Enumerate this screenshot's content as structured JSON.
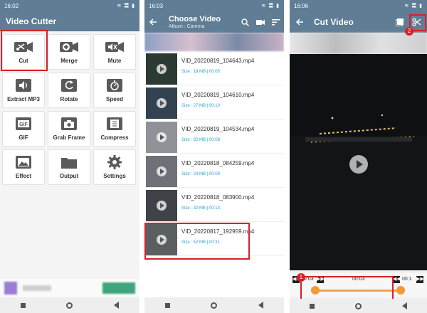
{
  "panel1": {
    "status_time": "16:02",
    "status_right": "≋ 〓 ▮",
    "title": "Video Cutter",
    "tools": [
      {
        "label": "Cut",
        "icon": "scissors-film-icon"
      },
      {
        "label": "Merge",
        "icon": "plus-film-icon"
      },
      {
        "label": "Mute",
        "icon": "mute-film-icon"
      },
      {
        "label": "Extract MP3",
        "icon": "speaker-icon"
      },
      {
        "label": "Rotate",
        "icon": "rotate-icon"
      },
      {
        "label": "Speed",
        "icon": "stopwatch-icon"
      },
      {
        "label": "GIF",
        "icon": "gif-icon"
      },
      {
        "label": "Grab Frame",
        "icon": "camera-icon"
      },
      {
        "label": "Compress",
        "icon": "compress-icon"
      },
      {
        "label": "Effect",
        "icon": "effect-icon"
      },
      {
        "label": "Output",
        "icon": "folder-icon"
      },
      {
        "label": "Settings",
        "icon": "gear-icon"
      }
    ]
  },
  "panel2": {
    "status_time": "16:03",
    "status_right": "≋ 〓 ▮",
    "title": "Choose Video",
    "subtitle": "Album : Camera",
    "videos": [
      {
        "name": "VID_20220819_104643.mp4",
        "meta": "Size : 18 MB | 00:05"
      },
      {
        "name": "VID_20220819_104610.mp4",
        "meta": "Size : 27 MB | 00:10"
      },
      {
        "name": "VID_20220819_104534.mp4",
        "meta": "Size : 32 MB | 00:08"
      },
      {
        "name": "VID_20220818_084259.mp4",
        "meta": "Size : 24 MB | 00:09"
      },
      {
        "name": "VID_20220818_083900.mp4",
        "meta": "Size : 32 MB | 00:13"
      },
      {
        "name": "VID_20220817_192959.mp4",
        "meta": "Size : 52 MB | 00:31"
      }
    ]
  },
  "panel3": {
    "status_time": "16:06",
    "status_right": "≋ 〓 ▮",
    "title": "Cut Video",
    "start_time": "00:03",
    "current_time": "00:03",
    "end_time": "00:1",
    "badge1": "1",
    "badge2": "2"
  },
  "colors": {
    "appbar": "#5f7d95",
    "highlight": "#d8202a",
    "accent": "#f39a34",
    "meta": "#2a9fd6"
  }
}
